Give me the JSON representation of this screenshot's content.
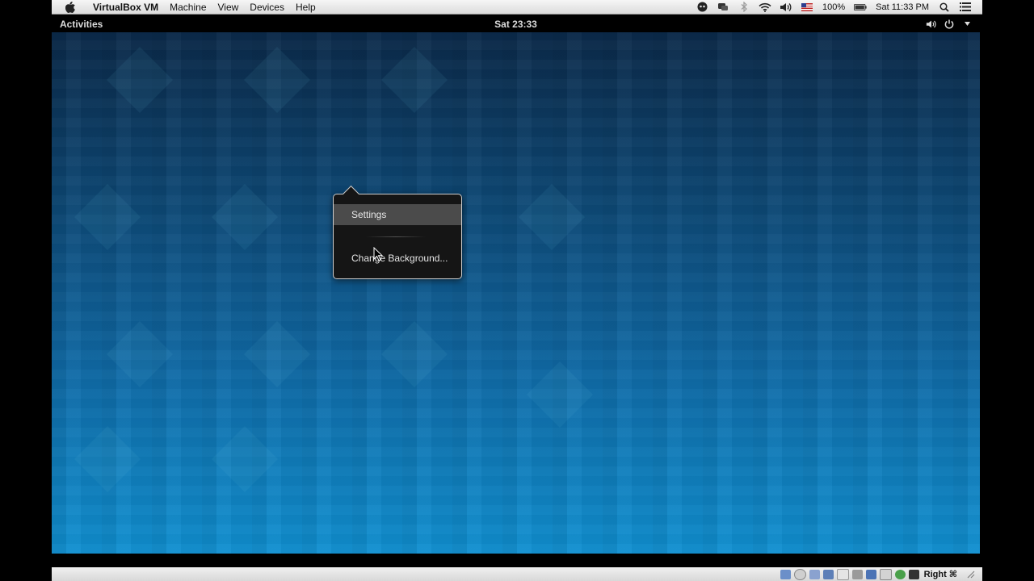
{
  "host_menubar": {
    "app_name": "VirtualBox VM",
    "menus": [
      "Machine",
      "View",
      "Devices",
      "Help"
    ],
    "battery": "100%",
    "clock": "Sat 11:33 PM"
  },
  "guest_topbar": {
    "activities": "Activities",
    "clock": "Sat 23:33"
  },
  "context_menu": {
    "items": [
      "Settings",
      "Change Background..."
    ],
    "highlighted": "Settings"
  },
  "vbox_status": {
    "host_key": "Right ⌘"
  },
  "colors": {
    "desktop_top": "#0b2a4a",
    "desktop_bottom": "#0f8fd0",
    "menu_bg": "#151515",
    "menu_highlight": "#4b4b4b"
  }
}
